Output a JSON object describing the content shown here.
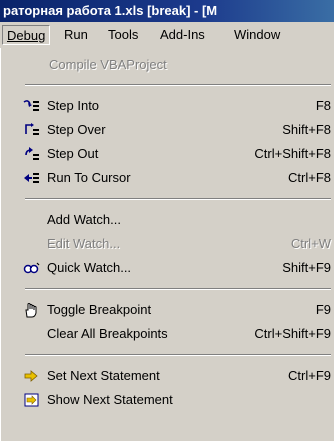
{
  "window": {
    "title": "раторная работа 1.xls [break] - [M"
  },
  "menubar": {
    "items": [
      {
        "label": "Debug",
        "underline": "D",
        "active": true
      },
      {
        "label": "Run",
        "underline": "R",
        "active": false
      },
      {
        "label": "Tools",
        "underline": "T",
        "active": false
      },
      {
        "label": "Add-Ins",
        "underline": "A",
        "active": false
      },
      {
        "label": "Window",
        "underline": "W",
        "active": false
      }
    ]
  },
  "debug_menu": {
    "items": [
      {
        "label": "Compile VBAProject",
        "shortcut": "",
        "disabled": true,
        "icon": "none"
      },
      {
        "label": "Step Into",
        "shortcut": "F8",
        "disabled": false,
        "icon": "step-into-icon"
      },
      {
        "label": "Step Over",
        "shortcut": "Shift+F8",
        "disabled": false,
        "icon": "step-over-icon"
      },
      {
        "label": "Step Out",
        "shortcut": "Ctrl+Shift+F8",
        "disabled": false,
        "icon": "step-out-icon"
      },
      {
        "label": "Run To Cursor",
        "shortcut": "Ctrl+F8",
        "disabled": false,
        "icon": "run-to-cursor-icon"
      },
      {
        "label": "Add Watch...",
        "shortcut": "",
        "disabled": false,
        "icon": "none"
      },
      {
        "label": "Edit Watch...",
        "shortcut": "Ctrl+W",
        "disabled": true,
        "icon": "none"
      },
      {
        "label": "Quick Watch...",
        "shortcut": "Shift+F9",
        "disabled": false,
        "icon": "quick-watch-icon"
      },
      {
        "label": "Toggle Breakpoint",
        "shortcut": "F9",
        "disabled": false,
        "icon": "hand-breakpoint-icon"
      },
      {
        "label": "Clear All Breakpoints",
        "shortcut": "Ctrl+Shift+F9",
        "disabled": false,
        "icon": "none"
      },
      {
        "label": "Set Next Statement",
        "shortcut": "Ctrl+F9",
        "disabled": false,
        "icon": "arrow-right-icon"
      },
      {
        "label": "Show Next Statement",
        "shortcut": "",
        "disabled": false,
        "icon": "show-next-statement-icon"
      }
    ]
  },
  "colors": {
    "title_bar": "#0a246a",
    "menu_bg": "#d4d0c8",
    "disabled_text": "#808080",
    "arrow_yellow": "#e8c000",
    "icon_blue": "#000080"
  }
}
